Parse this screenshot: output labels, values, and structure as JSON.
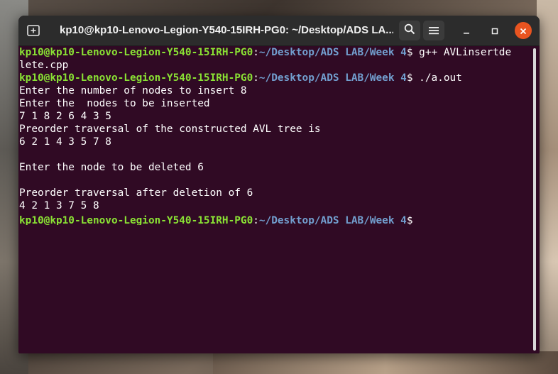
{
  "window": {
    "title": "kp10@kp10-Lenovo-Legion-Y540-15IRH-PG0: ~/Desktop/ADS LA...",
    "icons": {
      "new_tab": "new-tab-icon",
      "search": "search-icon",
      "menu": "hamburger-menu-icon",
      "minimize": "minimize-icon",
      "maximize": "maximize-icon",
      "close": "close-icon"
    }
  },
  "colors": {
    "terminal_bg": "#300a24",
    "prompt_user": "#8ae234",
    "prompt_path": "#729fcf",
    "close_button": "#e95420"
  },
  "terminal": {
    "prompt_user": "kp10@kp10-Lenovo-Legion-Y540-15IRH-PG0",
    "prompt_path": "~/Desktop/ADS LAB/Week 4",
    "lines": [
      {
        "type": "prompt",
        "cmd": " g++ AVLinsertde"
      },
      {
        "type": "output",
        "text": "lete.cpp"
      },
      {
        "type": "prompt",
        "cmd": " ./a.out"
      },
      {
        "type": "output",
        "text": "Enter the number of nodes to insert 8"
      },
      {
        "type": "output",
        "text": "Enter the  nodes to be inserted"
      },
      {
        "type": "output",
        "text": "7 1 8 2 6 4 3 5"
      },
      {
        "type": "output",
        "text": "Preorder traversal of the constructed AVL tree is"
      },
      {
        "type": "output",
        "text": "6 2 1 4 3 5 7 8"
      },
      {
        "type": "output",
        "text": ""
      },
      {
        "type": "output",
        "text": "Enter the node to be deleted 6"
      },
      {
        "type": "output",
        "text": ""
      },
      {
        "type": "output",
        "text": "Preorder traversal after deletion of 6"
      },
      {
        "type": "output",
        "text": "4 2 1 3 7 5 8"
      },
      {
        "type": "prompt",
        "cmd": ""
      }
    ]
  }
}
